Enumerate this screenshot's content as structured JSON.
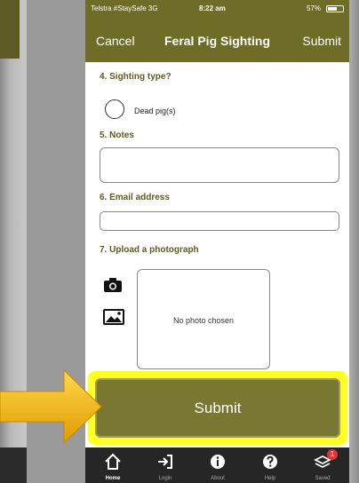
{
  "status_bar": {
    "carrier": "Telstra #StaySafe  3G",
    "time": "8:22 am",
    "battery": "57%"
  },
  "nav": {
    "cancel": "Cancel",
    "title": "Feral Pig Sighting",
    "submit": "Submit"
  },
  "form": {
    "q4": "4. Sighting type?",
    "radio_option": "Dead pig(s)",
    "q5": "5. Notes",
    "notes_value": "",
    "q6": "6. Email address",
    "email_value": "",
    "q7": "7. Upload a photograph",
    "photo_placeholder": "No photo chosen"
  },
  "submit_button": "Submit",
  "tabs": [
    {
      "label": "Home",
      "icon": "home-icon"
    },
    {
      "label": "Login",
      "icon": "login-icon"
    },
    {
      "label": "About",
      "icon": "info-icon"
    },
    {
      "label": "Help",
      "icon": "help-icon"
    },
    {
      "label": "Saved",
      "icon": "saved-icon",
      "badge": "1"
    }
  ],
  "colors": {
    "header": "#6f6c28",
    "highlight": "#ffff26",
    "button": "#7a7733",
    "arrow": "#f5b800",
    "badge": "#e53232"
  }
}
